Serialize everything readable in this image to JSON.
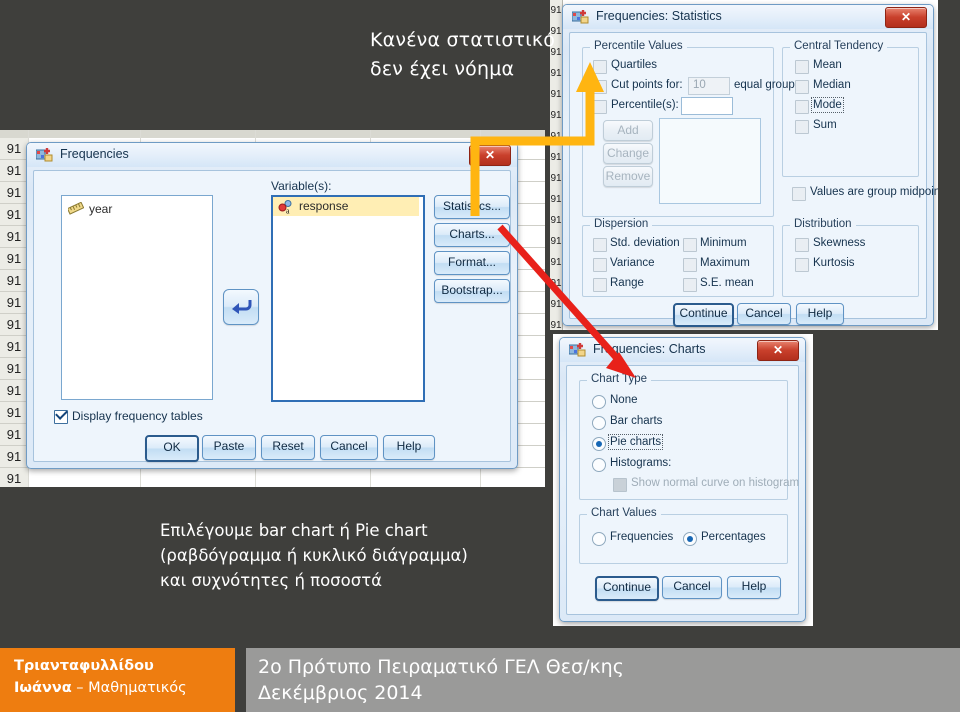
{
  "slide": {
    "note_top_line1": "Κανένα στατιστικό",
    "note_top_line2": "δεν έχει νόημα",
    "note_bottom_line1": "Επιλέγουμε bar chart ή Pie chart",
    "note_bottom_line2": "(ραβδόγραμμα ή κυκλικό διάγραμμα)",
    "note_bottom_line3": "και συχνότητες ή ποσοστά",
    "background_color": "#3f3f3c"
  },
  "footer": {
    "author_line1": "Τριανταφυλλίδου",
    "author_line2_bold": "Ιωάννα",
    "author_line2_rest": " – Μαθηματικός",
    "school": "2ο Πρότυπο Πειραματικό ΓΕΛ Θεσ/κης",
    "date": "Δεκέμβριος 2014",
    "accent_color": "#ee7d10",
    "bar_color": "#9a9a99"
  },
  "spreadsheet": {
    "row_value": "91",
    "row_count": 16
  },
  "frequencies": {
    "title": "Frequencies",
    "close_label": "✕",
    "source_list": [
      {
        "label": "year",
        "icon": "ruler-scale-icon"
      }
    ],
    "variables_label": "Variable(s):",
    "variables": [
      {
        "label": "response",
        "icon": "nominal-string-icon",
        "selected": true
      }
    ],
    "transfer_button_icon": "arrow-left-transfer-icon",
    "side_buttons": [
      {
        "label": "Statistics...",
        "accel": "S"
      },
      {
        "label": "Charts...",
        "accel": "C"
      },
      {
        "label": "Format...",
        "accel": "F"
      },
      {
        "label": "Bootstrap...",
        "accel": "B"
      }
    ],
    "display_freq_tables": {
      "label": "Display frequency tables",
      "accel": "D",
      "checked": true
    },
    "bottom_buttons": [
      {
        "label": "OK",
        "default": true
      },
      {
        "label": "Paste",
        "accel": "P"
      },
      {
        "label": "Reset",
        "accel": "R"
      },
      {
        "label": "Cancel"
      },
      {
        "label": "Help"
      }
    ]
  },
  "statistics_dialog": {
    "title": "Frequencies: Statistics",
    "close_label": "✕",
    "groups": {
      "percentile_values": {
        "caption": "Percentile Values",
        "quartiles": {
          "label": "Quartiles",
          "accel": "Q",
          "checked": false
        },
        "cut_points": {
          "label": "Cut points for:",
          "accel": "C",
          "checked": false,
          "value": "10",
          "suffix": "equal groups"
        },
        "percentiles": {
          "label": "Percentile(s):",
          "accel": "P",
          "checked": false,
          "value": ""
        },
        "buttons": [
          {
            "label": "Add",
            "enabled": false
          },
          {
            "label": "Change",
            "enabled": false
          },
          {
            "label": "Remove",
            "enabled": false
          }
        ]
      },
      "central_tendency": {
        "caption": "Central Tendency",
        "items": [
          {
            "label": "Mean",
            "checked": false
          },
          {
            "label": "Median",
            "checked": false
          },
          {
            "label": "Mode",
            "checked": false,
            "focused": true
          },
          {
            "label": "Sum",
            "checked": false
          }
        ]
      },
      "values_are_group_midpoints": {
        "label": "Values are group midpoints",
        "checked": false
      },
      "dispersion": {
        "caption": "Dispersion",
        "col1": [
          {
            "label": "Std. deviation",
            "checked": false
          },
          {
            "label": "Variance",
            "checked": false
          },
          {
            "label": "Range",
            "checked": false
          }
        ],
        "col2": [
          {
            "label": "Minimum",
            "checked": false
          },
          {
            "label": "Maximum",
            "checked": false
          },
          {
            "label": "S.E. mean",
            "checked": false
          }
        ]
      },
      "distribution": {
        "caption": "Distribution",
        "items": [
          {
            "label": "Skewness",
            "checked": false
          },
          {
            "label": "Kurtosis",
            "checked": false
          }
        ]
      }
    },
    "buttons": [
      {
        "label": "Continue",
        "default": true
      },
      {
        "label": "Cancel"
      },
      {
        "label": "Help"
      }
    ]
  },
  "charts_dialog": {
    "title": "Frequencies: Charts",
    "close_label": "✕",
    "chart_type": {
      "caption": "Chart Type",
      "options": [
        {
          "label": "None",
          "accel": "o",
          "selected": false
        },
        {
          "label": "Bar charts",
          "accel": "B",
          "selected": false
        },
        {
          "label": "Pie charts",
          "accel": "",
          "selected": true,
          "focused": true
        },
        {
          "label": "Histograms:",
          "accel": "H",
          "selected": false
        }
      ],
      "show_normal_curve": {
        "label": "Show normal curve on histogram",
        "checked": false,
        "enabled": false
      }
    },
    "chart_values": {
      "caption": "Chart Values",
      "options": [
        {
          "label": "Frequencies",
          "accel": "F",
          "selected": false
        },
        {
          "label": "Percentages",
          "accel": "c",
          "selected": true
        }
      ]
    },
    "buttons": [
      {
        "label": "Continue",
        "default": true
      },
      {
        "label": "Cancel"
      },
      {
        "label": "Help"
      }
    ]
  },
  "annotations": {
    "arrow_statistics_color": "#ffb511",
    "arrow_charts_color": "#e8211a"
  }
}
